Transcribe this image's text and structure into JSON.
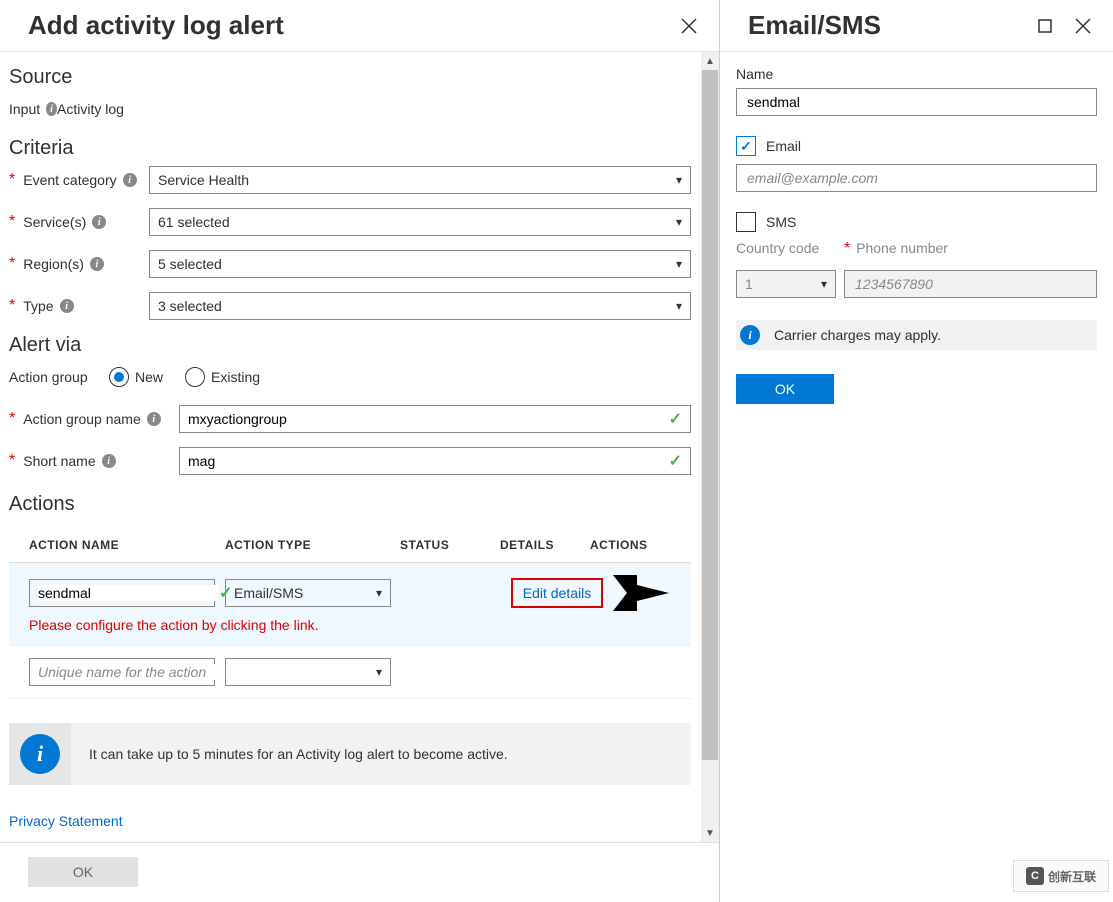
{
  "left": {
    "title": "Add activity log alert",
    "source": {
      "heading": "Source",
      "input_label": "Input",
      "input_value": "Activity log"
    },
    "criteria": {
      "heading": "Criteria",
      "event_category": {
        "label": "Event category",
        "value": "Service Health"
      },
      "services": {
        "label": "Service(s)",
        "value": "61 selected"
      },
      "regions": {
        "label": "Region(s)",
        "value": "5 selected"
      },
      "type": {
        "label": "Type",
        "value": "3 selected"
      }
    },
    "alert_via": {
      "heading": "Alert via",
      "action_group_label": "Action group",
      "radio_new": "New",
      "radio_existing": "Existing",
      "group_name_label": "Action group name",
      "group_name_value": "mxyactiongroup",
      "short_name_label": "Short name",
      "short_name_value": "mag"
    },
    "actions": {
      "heading": "Actions",
      "headers": {
        "name": "ACTION NAME",
        "type": "ACTION TYPE",
        "status": "STATUS",
        "details": "DETAILS",
        "actions": "ACTIONS"
      },
      "row1": {
        "name": "sendmal",
        "type": "Email/SMS",
        "edit": "Edit details",
        "warn": "Please configure the action by clicking the link."
      },
      "row2_placeholder": "Unique name for the action"
    },
    "info_text": "It can take up to 5 minutes for an Activity log alert to become active.",
    "privacy": "Privacy Statement",
    "ok": "OK"
  },
  "right": {
    "title": "Email/SMS",
    "name_label": "Name",
    "name_value": "sendmal",
    "email_label": "Email",
    "email_placeholder": "email@example.com",
    "sms_label": "SMS",
    "country_code_label": "Country code",
    "country_code_value": "1",
    "phone_label": "Phone number",
    "phone_placeholder": "1234567890",
    "carrier_text": "Carrier charges may apply.",
    "ok": "OK"
  },
  "watermark": "创新互联"
}
